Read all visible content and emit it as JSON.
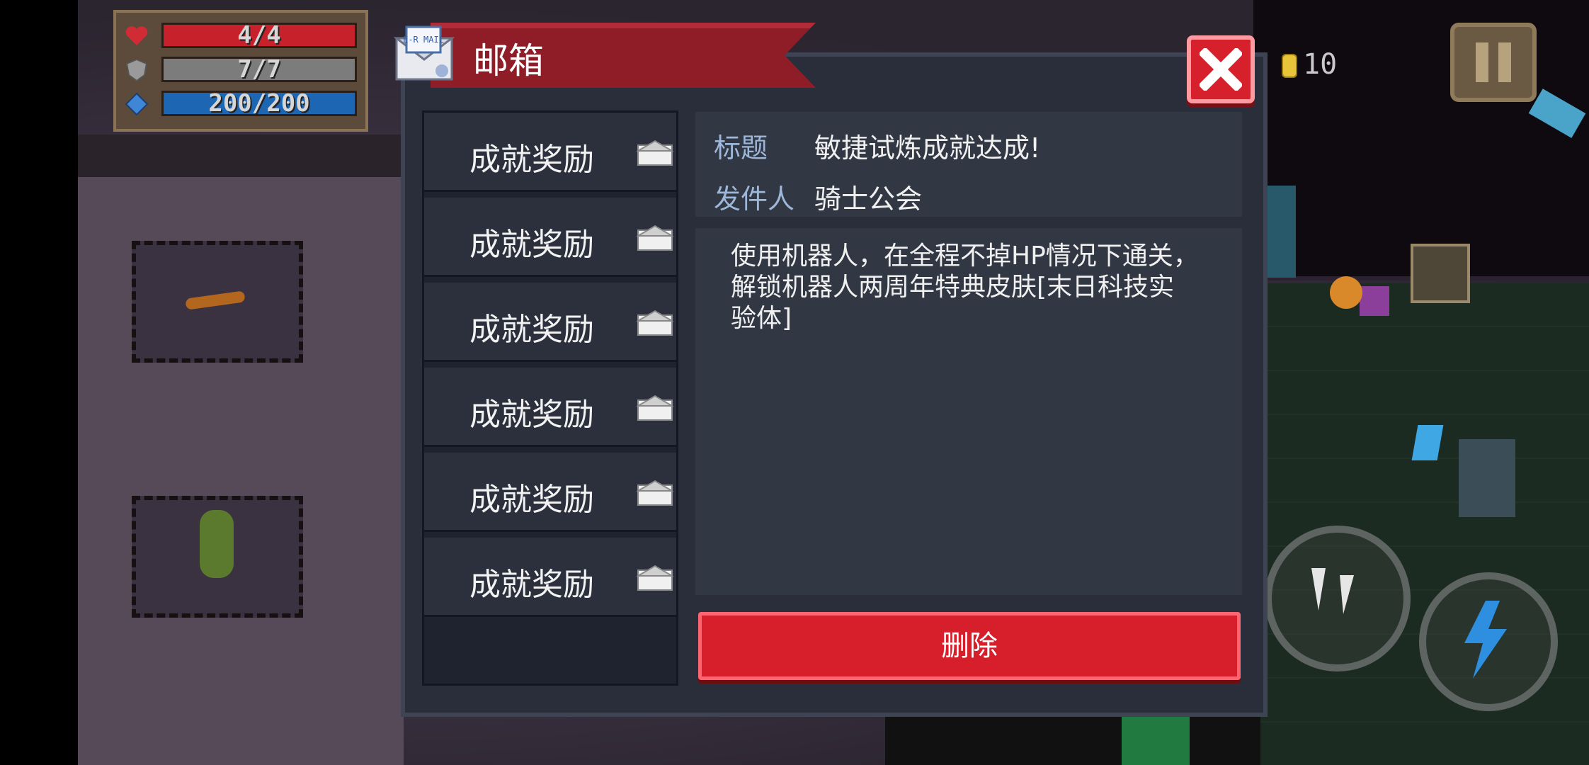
{
  "hud": {
    "health": {
      "text": "4/4",
      "current": 4,
      "max": 4,
      "color": "#c7212b"
    },
    "armor": {
      "text": "7/7",
      "current": 7,
      "max": 7,
      "color": "#7c7c7c"
    },
    "energy": {
      "text": "200/200",
      "current": 200,
      "max": 200,
      "color": "#1d66b3"
    },
    "coins": "10"
  },
  "mailbox": {
    "title": "邮箱",
    "envelope_icon_text": "E-R MAIL",
    "mails": [
      {
        "label": "成就奖励"
      },
      {
        "label": "成就奖励"
      },
      {
        "label": "成就奖励"
      },
      {
        "label": "成就奖励"
      },
      {
        "label": "成就奖励"
      },
      {
        "label": "成就奖励"
      }
    ],
    "detail": {
      "title_label": "标题",
      "title_value": "敏捷试炼成就达成!",
      "sender_label": "发件人",
      "sender_value": "骑士公会",
      "body": "使用机器人，在全程不掉HP情况下通关，\n解锁机器人两周年特典皮肤[末日科技实\n验体]"
    },
    "delete_label": "删除"
  },
  "colors": {
    "ribbon": "#8f1d28",
    "accent_red": "#d71f2b",
    "panel": "#2a2e3b",
    "label_blue": "#9eb6d8"
  },
  "icons": [
    "heart-icon",
    "shield-icon",
    "energy-crystal-icon",
    "coin-icon",
    "pause-icon",
    "mail-envelope-icon",
    "close-icon",
    "envelope-icon",
    "lightning-skill-icon",
    "exclamation-skill-icon"
  ]
}
